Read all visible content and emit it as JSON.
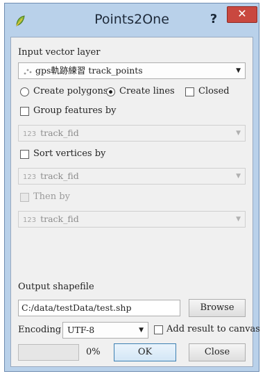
{
  "window": {
    "title": "Points2One",
    "help_label": "?",
    "close_label": "✕",
    "app_icon": "qgis-leaf-icon"
  },
  "input": {
    "label": "Input vector layer",
    "layer_icon": "point-layer-icon",
    "layer_value": "gps軌跡練習 track_points"
  },
  "mode": {
    "polygons_label": "Create polygons",
    "polygons_checked": false,
    "lines_label": "Create lines",
    "lines_checked": true,
    "closed_label": "Closed",
    "closed_checked": false
  },
  "group": {
    "label": "Group features by",
    "checked": false,
    "field_prefix": "123",
    "field_value": "track_fid"
  },
  "sort": {
    "label": "Sort vertices by",
    "checked": false,
    "field_prefix": "123",
    "field_value": "track_fid"
  },
  "then": {
    "label": "Then by",
    "checked": false,
    "enabled": false,
    "field_prefix": "123",
    "field_value": "track_fid"
  },
  "output": {
    "label": "Output shapefile",
    "path": "C:/data/testData/test.shp",
    "browse_label": "Browse"
  },
  "encoding": {
    "label": "Encoding",
    "value": "UTF-8",
    "add_result_label": "Add result to canvas",
    "add_result_checked": false
  },
  "footer": {
    "progress_text": "0%",
    "progress_fraction": 0,
    "ok_label": "OK",
    "close_label": "Close"
  },
  "colors": {
    "frame": "#b9d1ea",
    "close_button": "#c9483f",
    "progress": "#06b025"
  }
}
